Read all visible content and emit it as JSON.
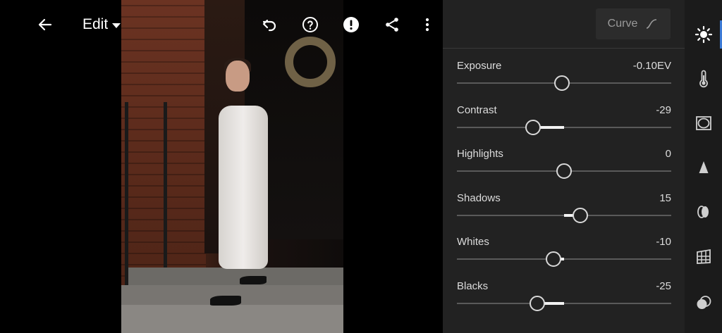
{
  "header": {
    "title": "Edit"
  },
  "toolbar": {
    "icons": [
      "back-arrow-icon",
      "undo-icon",
      "help-icon",
      "alert-icon",
      "share-icon",
      "more-vertical-icon"
    ]
  },
  "panel": {
    "curve_label": "Curve",
    "adjustments": [
      {
        "label": "Exposure",
        "value": "-0.10EV",
        "position": 0.491
      },
      {
        "label": "Contrast",
        "value": "-29",
        "position": 0.355
      },
      {
        "label": "Highlights",
        "value": "0",
        "position": 0.5
      },
      {
        "label": "Shadows",
        "value": "15",
        "position": 0.575
      },
      {
        "label": "Whites",
        "value": "-10",
        "position": 0.45
      },
      {
        "label": "Blacks",
        "value": "-25",
        "position": 0.375
      }
    ]
  },
  "rail": {
    "active": "light-icon",
    "items": [
      "light-icon",
      "color-temperature-icon",
      "effects-icon",
      "detail-icon",
      "optics-icon",
      "geometry-icon",
      "presets-icon"
    ]
  },
  "colors": {
    "panel_bg": "#222222",
    "rail_bg": "#1b1b1b",
    "accent": "#3d7bd6"
  }
}
